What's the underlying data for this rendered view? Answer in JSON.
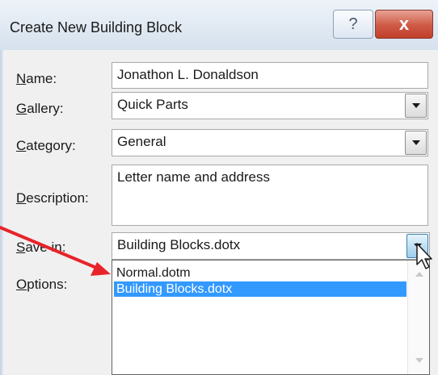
{
  "window": {
    "title": "Create New Building Block",
    "help_glyph": "?",
    "close_glyph": "x"
  },
  "form": {
    "name": {
      "label_key": "N",
      "label_rest": "ame:",
      "value": "Jonathon L. Donaldson"
    },
    "gallery": {
      "label_key": "G",
      "label_rest": "allery:",
      "value": "Quick Parts"
    },
    "category": {
      "label_key": "C",
      "label_rest": "ategory:",
      "value": "General"
    },
    "description": {
      "label_key": "D",
      "label_rest": "escription:",
      "value": "Letter name and address"
    },
    "save_in": {
      "label_key": "S",
      "label_rest": "ave in:",
      "value": "Building Blocks.dotx"
    },
    "options": {
      "label_key": "O",
      "label_rest": "ptions:"
    }
  },
  "save_in_dropdown": {
    "options": [
      "Normal.dotm",
      "Building Blocks.dotx"
    ],
    "selected": "Building Blocks.dotx"
  },
  "colors": {
    "annotation_arrow": "#e8232a",
    "selection": "#3399ff",
    "close_button": "#cf5a45"
  },
  "icons": [
    "help-icon",
    "close-icon",
    "dropdown-arrow-icon",
    "mouse-cursor-icon",
    "annotation-arrow-icon"
  ]
}
